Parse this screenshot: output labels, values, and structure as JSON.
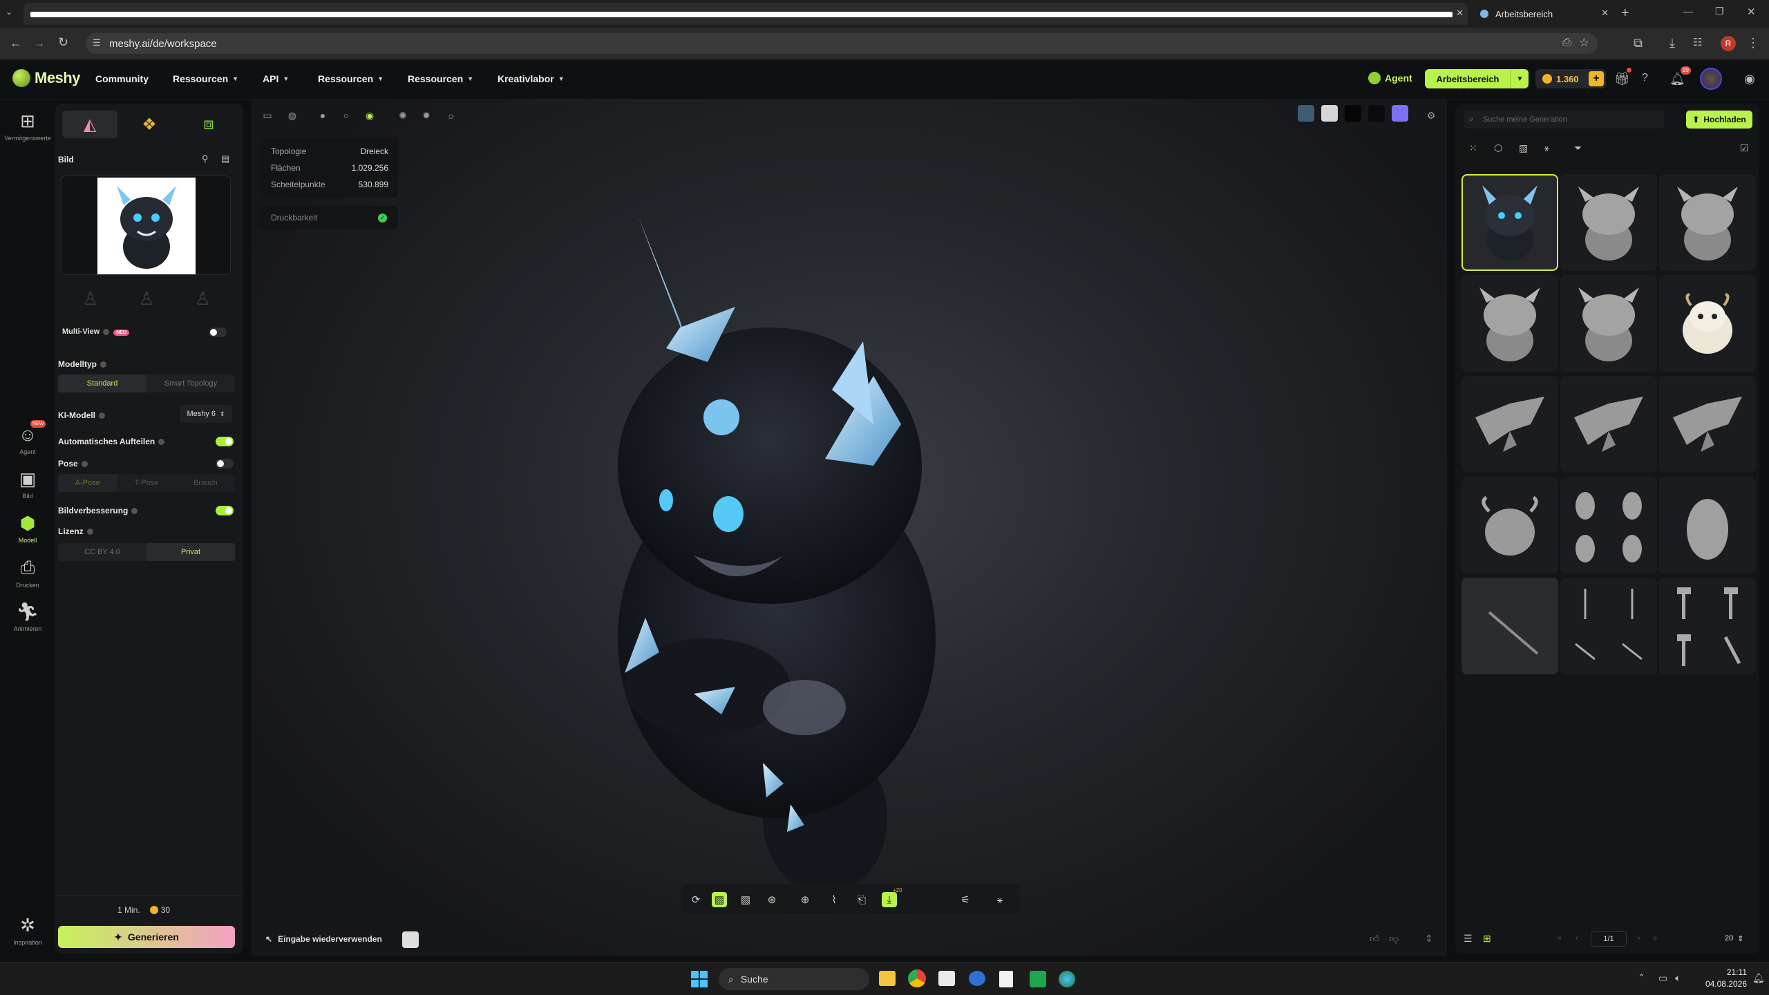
{
  "browser": {
    "tab1_title": "",
    "tab2_title": "Arbeitsbereich",
    "url": "meshy.ai/de/workspace"
  },
  "header": {
    "logo": "Meshy",
    "nav": [
      "Community",
      "Ressourcen",
      "API",
      "Ressourcen",
      "Ressourcen",
      "Kreativlabor"
    ],
    "agent_label": "Agent",
    "workspace_button": "Arbeitsbereich",
    "credits": "1.360",
    "notif_badge": "99"
  },
  "rail": [
    {
      "label": "Vermögenswerte",
      "icon": "grid-icon"
    },
    {
      "label": "Agent",
      "icon": "agent-icon",
      "badge": "NEW"
    },
    {
      "label": "Bild",
      "icon": "image-icon"
    },
    {
      "label": "Modell",
      "icon": "cube-icon"
    },
    {
      "label": "Drucken",
      "icon": "printer-icon"
    },
    {
      "label": "Animieren",
      "icon": "run-icon"
    },
    {
      "label": "Inspiration",
      "icon": "sparkle-icon"
    }
  ],
  "left": {
    "image_label": "Bild",
    "multiview_label": "Multi-View",
    "multiview_badge": "NEU",
    "modeltype_label": "Modelltyp",
    "modeltype_opts": [
      "Standard",
      "Smart Topology"
    ],
    "ai_model_label": "KI-Modell",
    "ai_model_value": "Meshy 6",
    "auto_split_label": "Automatisches Aufteilen",
    "pose_label": "Pose",
    "pose_opts": [
      "A-Pose",
      "T-Pose",
      "Brauch"
    ],
    "enhance_label": "Bildverbesserung",
    "license_label": "Lizenz",
    "license_opts": [
      "CC BY 4.0",
      "Privat"
    ],
    "time": "1 Min.",
    "cost": "30",
    "generate": "Generieren"
  },
  "stats": {
    "rows": [
      {
        "k": "Topologie",
        "v": "Dreieck"
      },
      {
        "k": "Flächen",
        "v": "1.029.256"
      },
      {
        "k": "Scheitelpunkte",
        "v": "530.899"
      }
    ],
    "printability": "Druckbarkeit"
  },
  "viewport": {
    "reuse_input": "Eingabe wiederverwenden",
    "retexture_badge": "+20"
  },
  "right": {
    "search_placeholder": "Suche meine Generation",
    "upload": "Hochladen",
    "page": "1/1",
    "per_page": "20"
  },
  "taskbar": {
    "search": "Suche",
    "time": "21:11",
    "date": "04.08.2026"
  },
  "colors": {
    "accent": "#b8f24a",
    "gold": "#f0b429"
  }
}
